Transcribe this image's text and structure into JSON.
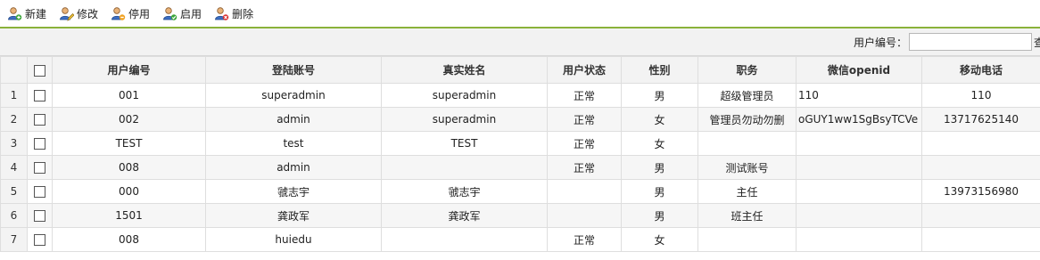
{
  "toolbar": {
    "buttons": [
      {
        "label": "新建",
        "icon": "user-add-icon"
      },
      {
        "label": "修改",
        "icon": "user-edit-icon"
      },
      {
        "label": "停用",
        "icon": "user-disable-icon"
      },
      {
        "label": "启用",
        "icon": "user-enable-icon"
      },
      {
        "label": "删除",
        "icon": "user-delete-icon"
      }
    ]
  },
  "search": {
    "label": "用户编号：",
    "value": "",
    "placeholder": "",
    "trailing_fragment": "查"
  },
  "table": {
    "headers": [
      "用户编号",
      "登陆账号",
      "真实姓名",
      "用户状态",
      "性别",
      "职务",
      "微信openid",
      "移动电话"
    ],
    "rows": [
      {
        "num": "1",
        "cells": [
          "001",
          "superadmin",
          "superadmin",
          "正常",
          "男",
          "超级管理员",
          "110",
          "110"
        ]
      },
      {
        "num": "2",
        "cells": [
          "002",
          "admin",
          "superadmin",
          "正常",
          "女",
          "管理员勿动勿删",
          "oGUY1ww1SgBsyTCVe",
          "13717625140"
        ]
      },
      {
        "num": "3",
        "cells": [
          "TEST",
          "test",
          "TEST",
          "正常",
          "女",
          "",
          "",
          ""
        ]
      },
      {
        "num": "4",
        "cells": [
          "008",
          "admin",
          "",
          "正常",
          "男",
          "测试账号",
          "",
          ""
        ]
      },
      {
        "num": "5",
        "cells": [
          "000",
          "虢志宇",
          "虢志宇",
          "",
          "男",
          "主任",
          "",
          "13973156980"
        ]
      },
      {
        "num": "6",
        "cells": [
          "1501",
          "龚政军",
          "龚政军",
          "",
          "男",
          "班主任",
          "",
          ""
        ]
      },
      {
        "num": "7",
        "cells": [
          "008",
          "huiedu",
          "",
          "正常",
          "女",
          "",
          "",
          ""
        ]
      }
    ]
  },
  "colors": {
    "toolbar_accent": "#8ab23a",
    "header_bg": "#f3f3f3",
    "grid_border": "#dedede"
  }
}
